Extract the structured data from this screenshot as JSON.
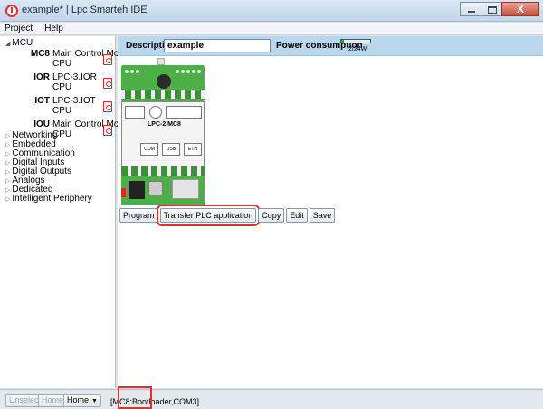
{
  "window": {
    "title": "example* | Lpc Smarteh IDE",
    "close_glyph": "X"
  },
  "menu": {
    "items": [
      "Project",
      "Help"
    ]
  },
  "sidebar": {
    "root_label": "MCU",
    "modules": [
      {
        "code": "MC8",
        "name": "Main Control Module",
        "sub": "CPU"
      },
      {
        "code": "IOR",
        "name": "LPC-3.IOR",
        "sub": "CPU"
      },
      {
        "code": "IOT",
        "name": "LPC-3.IOT",
        "sub": "CPU"
      },
      {
        "code": "IOU",
        "name": "Main Control Module",
        "sub": "CPU"
      }
    ],
    "categories": [
      "Networking",
      "Embedded",
      "Communication",
      "Digital Inputs",
      "Digital Outputs",
      "Analogs",
      "Dedicated",
      "Intelligent Periphery"
    ]
  },
  "main": {
    "description_label": "Description",
    "description_value": "example",
    "power_label": "Power consumption",
    "power_value": "2/24W",
    "power_fraction": 0.083,
    "device_label": "LPC-2.MC8",
    "device_ports": [
      "COM",
      "USB",
      "ETH"
    ],
    "buttons": {
      "program": "Program",
      "transfer": "Transfer PLC application",
      "copy": "Copy",
      "edit": "Edit",
      "save": "Save"
    }
  },
  "statusbar": {
    "unselect": "Unselect",
    "home_disabled": "Home",
    "home_dropdown": "Home",
    "status_text": "[MC8:Bootloader,COM3]"
  },
  "colors": {
    "description_bar": "#b9d8ee",
    "highlight": "#dd3333",
    "device_green": "#4caf47"
  }
}
